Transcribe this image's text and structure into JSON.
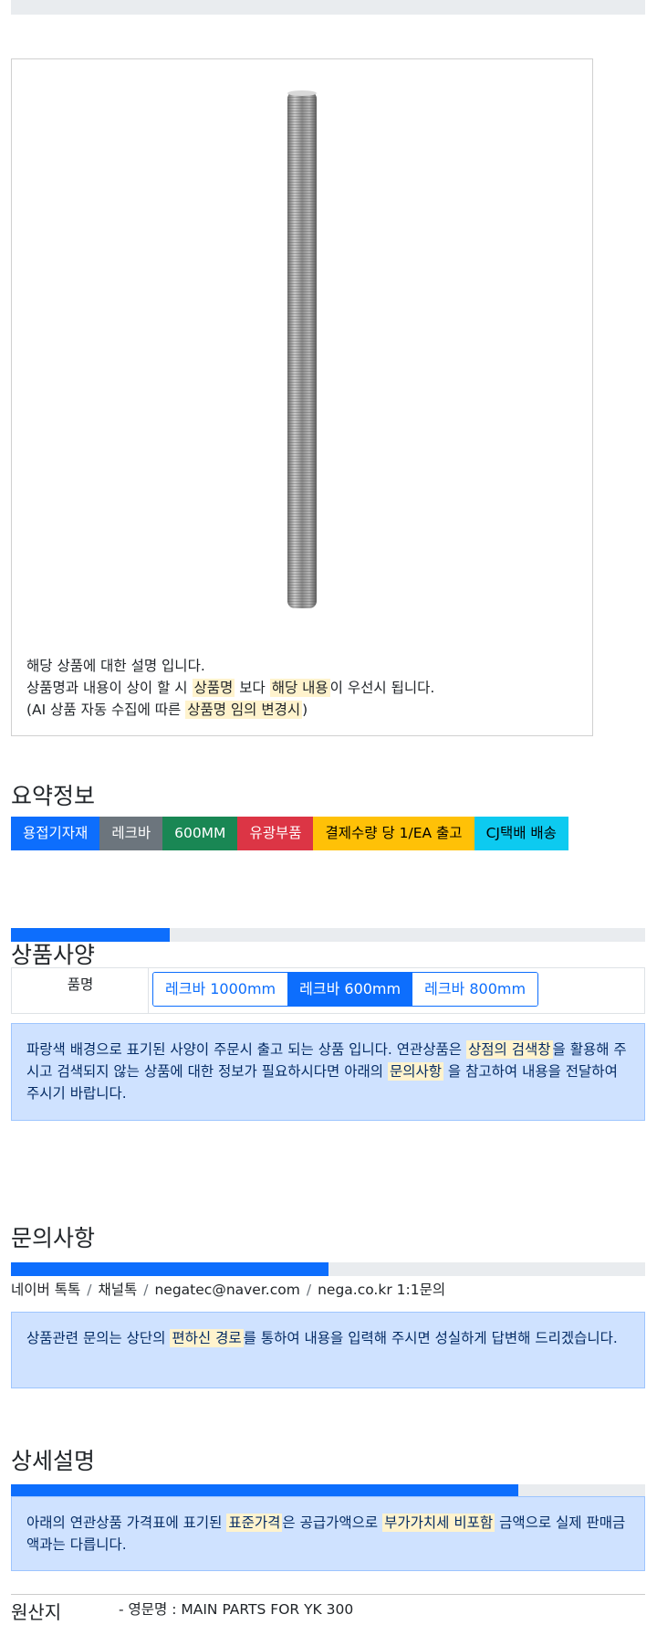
{
  "description": {
    "line1": "해당 상품에 대한 설명 입니다.",
    "line2_a": "상품명과 내용이 상이 할 시",
    "line2_h1": "상품명",
    "line2_b": "보다",
    "line2_h2": "해당 내용",
    "line2_c": "이 우선시 됩니다.",
    "line3_a": "(AI 상품 자동 수집에 따른",
    "line3_h": "상품명 임의 변경시",
    "line3_b": ")"
  },
  "summary": {
    "title": "요약정보",
    "badges": [
      {
        "label": "용접기자재",
        "color": "#0d6efd",
        "text_color": "#ffffff"
      },
      {
        "label": "레크바",
        "color": "#6c757d",
        "text_color": "#ffffff"
      },
      {
        "label": "600MM",
        "color": "#198754",
        "text_color": "#ffffff"
      },
      {
        "label": "유광부품",
        "color": "#dc3545",
        "text_color": "#ffffff"
      },
      {
        "label": "결제수량 당 1/EA 출고",
        "color": "#ffc107",
        "text_color": "#000000"
      },
      {
        "label": "CJ택배 배송",
        "color": "#0dcaf0",
        "text_color": "#000000"
      }
    ]
  },
  "spec": {
    "title": "상품사양",
    "progress": 0.25,
    "label": "품명",
    "options": [
      "레크바 1000mm",
      "레크바 600mm",
      "레크바 800mm"
    ],
    "selected": "레크바 600mm",
    "notice_a": "파랑색 배경으로 표기된 사양이 주문시 출고 되는 상품 입니다. 연관상품은",
    "notice_h1": "상점의 검색창",
    "notice_b": "을 활용해 주시고 검색되지 않는 상품에 대한 정보가 필요하시다면 아래의",
    "notice_h2": "문의사항",
    "notice_c": "을 참고하여 내용을 전달하여 주시기 바랍니다."
  },
  "inquiry": {
    "title": "문의사항",
    "progress": 0.5,
    "channels": [
      "네이버 톡톡",
      "채널톡",
      "negatec@naver.com",
      "nega.co.kr 1:1문의"
    ],
    "notice_a": "상품관련 문의는 상단의",
    "notice_h": "편하신 경로",
    "notice_b": "를 통하여 내용을 입력해 주시면 성실하게 답변해 드리겠습니다."
  },
  "detail": {
    "title": "상세설명",
    "progress": 0.8,
    "notice_a": "아래의 연관상품 가격표에 표기된",
    "notice_h1": "표준가격",
    "notice_b": "은 공급가액으로",
    "notice_h2": "부가가치세 비포함",
    "notice_c": "금액으로 실제 판매금액과는 다릅니다."
  },
  "origin": {
    "label": "원산지",
    "value": "- 영문명 : MAIN PARTS FOR YK 300"
  },
  "colors": {
    "primary": "#0d6efd",
    "highlight": "#fff3cd",
    "alert_bg": "#cfe2ff"
  }
}
